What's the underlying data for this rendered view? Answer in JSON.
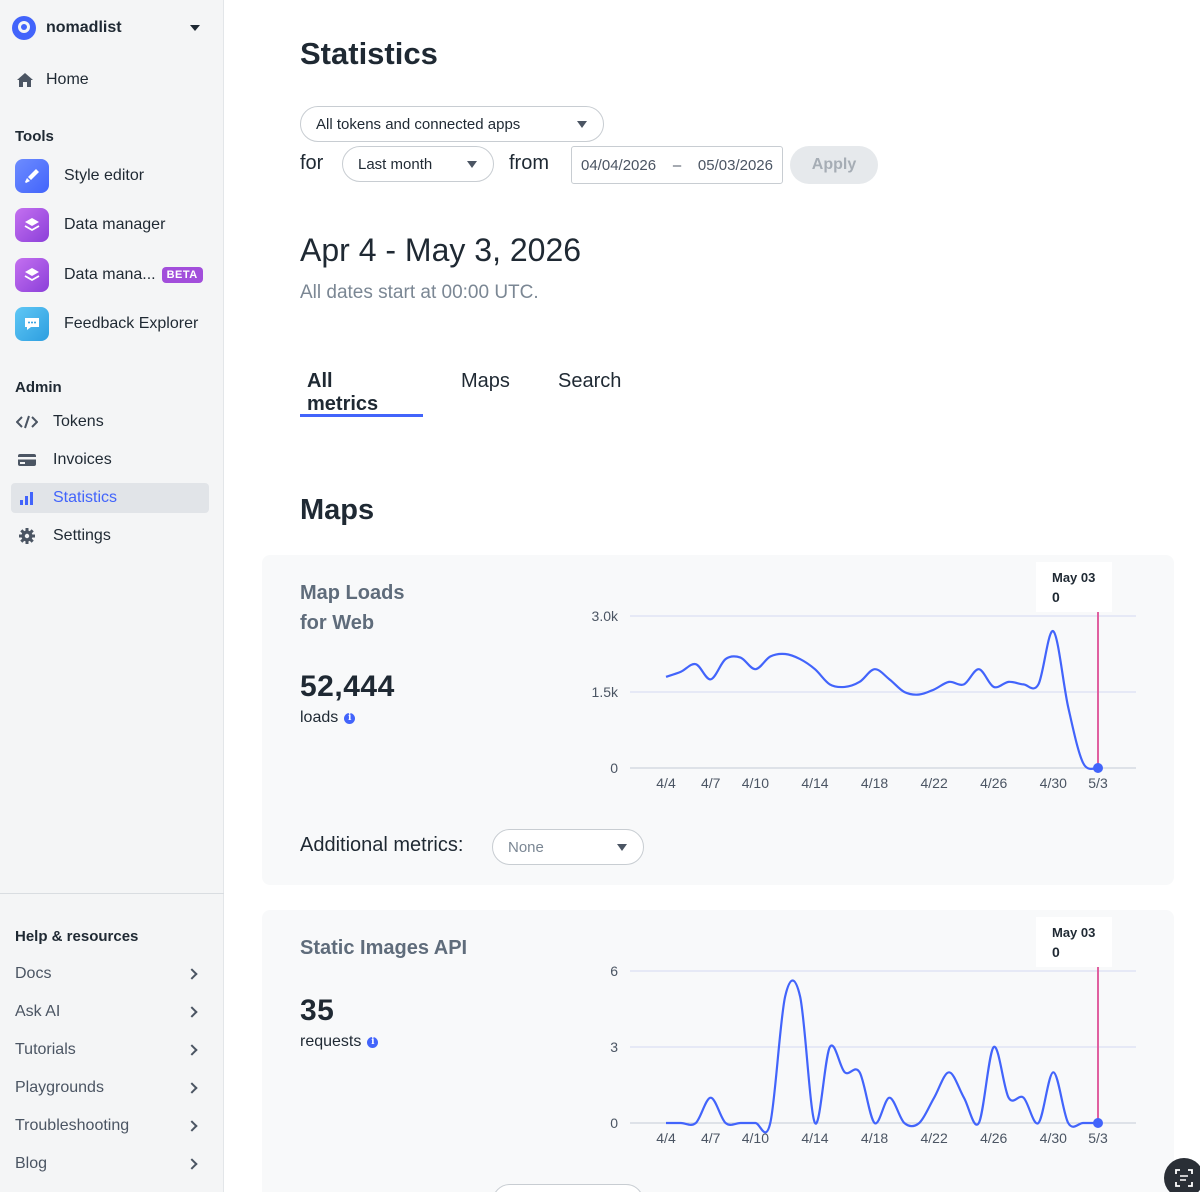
{
  "sidebar": {
    "account": "nomadlist",
    "home": "Home",
    "tools_title": "Tools",
    "tools": [
      {
        "label": "Style editor",
        "icon": "brush-icon"
      },
      {
        "label": "Data manager",
        "icon": "layers-icon"
      },
      {
        "label": "Data mana...",
        "icon": "layers-icon",
        "badge": "BETA"
      },
      {
        "label": "Feedback Explorer",
        "icon": "chat-bubble-icon"
      }
    ],
    "admin_title": "Admin",
    "admin": [
      {
        "label": "Tokens",
        "icon": "code-icon"
      },
      {
        "label": "Invoices",
        "icon": "credit-card-icon"
      },
      {
        "label": "Statistics",
        "icon": "bar-chart-icon",
        "active": true
      },
      {
        "label": "Settings",
        "icon": "gear-icon"
      }
    ],
    "help_title": "Help & resources",
    "help": [
      "Docs",
      "Ask AI",
      "Tutorials",
      "Playgrounds",
      "Troubleshooting",
      "Blog"
    ]
  },
  "main": {
    "title": "Statistics",
    "token_select": "All tokens and connected apps",
    "for_label": "for",
    "period_select": "Last month",
    "from_label": "from",
    "date_start": "04/04/2026",
    "date_sep": "–",
    "date_end": "05/03/2026",
    "apply": "Apply",
    "range_title": "Apr 4 - May 3, 2026",
    "range_note": "All dates start at 00:00 UTC.",
    "tabs": [
      "All metrics",
      "Maps",
      "Search"
    ],
    "section": "Maps"
  },
  "cards": [
    {
      "title_line1": "Map Loads",
      "title_line2": "for Web",
      "total": "52,444",
      "unit": "loads",
      "tooltip_date": "May 03",
      "tooltip_value": "0",
      "additional_label": "Additional metrics:",
      "additional_value": "None"
    },
    {
      "title_line1": "Static Images API",
      "total": "35",
      "unit": "requests",
      "tooltip_date": "May 03",
      "tooltip_value": "0"
    }
  ],
  "chart_data": [
    {
      "type": "line",
      "title": "Map Loads for Web",
      "x": [
        "4/4",
        "4/5",
        "4/6",
        "4/7",
        "4/8",
        "4/9",
        "4/10",
        "4/11",
        "4/12",
        "4/13",
        "4/14",
        "4/15",
        "4/16",
        "4/17",
        "4/18",
        "4/19",
        "4/20",
        "4/21",
        "4/22",
        "4/23",
        "4/24",
        "4/25",
        "4/26",
        "4/27",
        "4/28",
        "4/29",
        "4/30",
        "5/1",
        "5/2",
        "5/3"
      ],
      "x_ticks": [
        "4/4",
        "4/7",
        "4/10",
        "4/14",
        "4/18",
        "4/22",
        "4/26",
        "4/30",
        "5/3"
      ],
      "y_ticks": [
        "0",
        "1.5k",
        "3.0k"
      ],
      "ylim": [
        0,
        3000
      ],
      "values": [
        1800,
        1900,
        2050,
        1750,
        2150,
        2180,
        1950,
        2200,
        2250,
        2150,
        1950,
        1650,
        1600,
        1700,
        1950,
        1750,
        1500,
        1450,
        1550,
        1700,
        1650,
        1950,
        1600,
        1700,
        1650,
        1650,
        2700,
        1200,
        100,
        0
      ],
      "color": "#4264fb",
      "marker_color": "#e060a0"
    },
    {
      "type": "line",
      "title": "Static Images API",
      "x": [
        "4/4",
        "4/5",
        "4/6",
        "4/7",
        "4/8",
        "4/9",
        "4/10",
        "4/11",
        "4/12",
        "4/13",
        "4/14",
        "4/15",
        "4/16",
        "4/17",
        "4/18",
        "4/19",
        "4/20",
        "4/21",
        "4/22",
        "4/23",
        "4/24",
        "4/25",
        "4/26",
        "4/27",
        "4/28",
        "4/29",
        "4/30",
        "5/1",
        "5/2",
        "5/3"
      ],
      "x_ticks": [
        "4/4",
        "4/7",
        "4/10",
        "4/14",
        "4/18",
        "4/22",
        "4/26",
        "4/30",
        "5/3"
      ],
      "y_ticks": [
        "0",
        "3",
        "6"
      ],
      "ylim": [
        0,
        6
      ],
      "values": [
        0,
        0,
        0,
        1,
        0,
        0,
        0,
        0,
        5,
        5,
        0,
        3,
        2,
        2,
        0,
        1,
        0,
        0,
        1,
        2,
        1,
        0,
        3,
        1,
        1,
        0,
        2,
        0,
        0,
        0
      ],
      "color": "#4264fb",
      "marker_color": "#e060a0"
    }
  ]
}
